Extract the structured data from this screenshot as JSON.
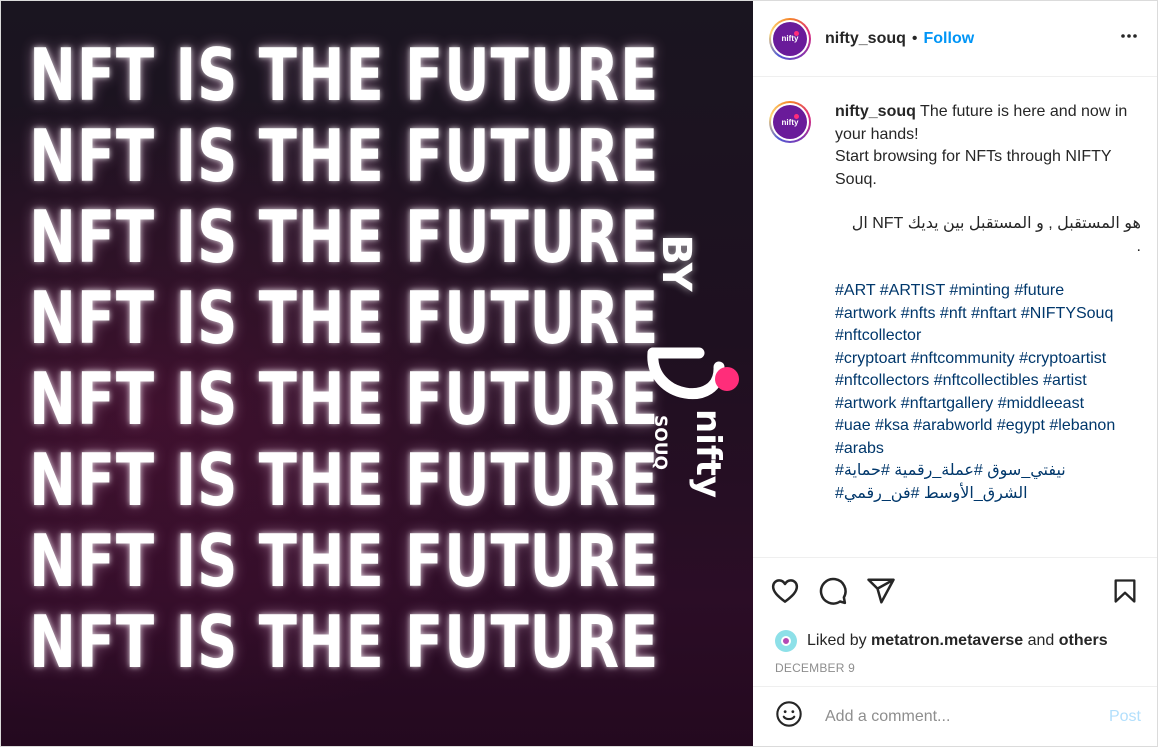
{
  "media": {
    "headline_lines": [
      "NFT IS THE FUTURE",
      "NFT IS THE FUTURE",
      "NFT IS THE FUTURE",
      "NFT IS THE FUTURE",
      "NFT IS THE FUTURE",
      "NFT IS THE FUTURE",
      "NFT IS THE FUTURE",
      "NFT IS THE FUTURE"
    ],
    "by_text": "BY",
    "brand_logo_text": "nifty souq",
    "colors": {
      "background_top": "#1a1520",
      "background_bottom": "#2b0d26",
      "accent_dot": "#ff2d7a"
    }
  },
  "header": {
    "username": "nifty_souq",
    "bullet": "•",
    "follow_label": "Follow",
    "more_icon": "more-horizontal-icon"
  },
  "caption": {
    "username": "nifty_souq",
    "line1": "The future is here and now in your hands!",
    "line2": "Start browsing for NFTs through NIFTY Souq.",
    "arabic_line": "هو المستقبل , و المستقبل بين يديك NFT ال",
    "arabic_dot": ".",
    "hashtag_lines": [
      "#ART #ARTIST #minting #future",
      "#artwork #nfts #nft #nftart #NIFTYSouq",
      "#nftcollector",
      "#cryptoart #nftcommunity #cryptoartist",
      "#nftcollectors #nftcollectibles #artist",
      "#artwork #nftartgallery #middleeast",
      "#uae #ksa #arabworld #egypt #lebanon",
      "#arabs"
    ],
    "arabic_hashtag_lines": [
      "نيفتي_سوق #عملة_رقمية #حماية#",
      "الشرق_الأوسط #فن_رقمي#"
    ]
  },
  "actions": {
    "icons": [
      "heart-icon",
      "comment-icon",
      "share-icon",
      "bookmark-icon"
    ],
    "link_color": "#00376b",
    "accent_color": "#0095f6"
  },
  "likes": {
    "prefix": "Liked by",
    "user": "metatron.metaverse",
    "and": "and",
    "others": "others"
  },
  "date": "DECEMBER 9",
  "comment": {
    "placeholder": "Add a comment...",
    "post_label": "Post"
  }
}
